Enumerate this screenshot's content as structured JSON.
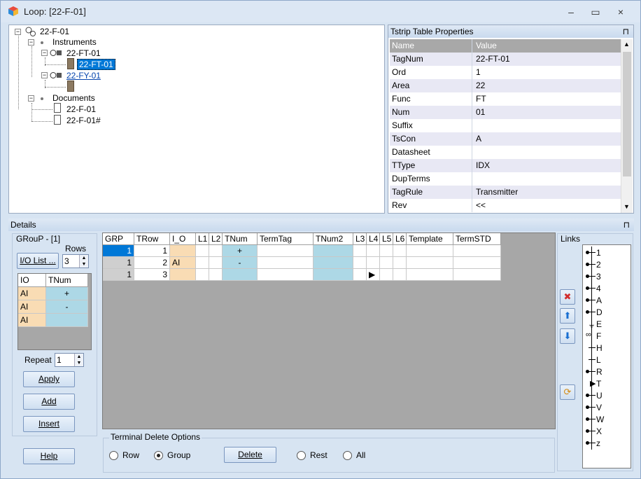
{
  "window": {
    "title": "Loop: [22-F-01]",
    "minimize": "–",
    "maximize": "▭",
    "close": "×"
  },
  "tree": {
    "root": "22-F-01",
    "instruments": "Instruments",
    "ft": "22-FT-01",
    "ft_child": "22-FT-01",
    "fy": "22-FY-01",
    "documents": "Documents",
    "doc1": "22-F-01",
    "doc2": "22-F-01#"
  },
  "props": {
    "header": "Tstrip Table Properties",
    "pin": "⊓",
    "col_name": "Name",
    "col_value": "Value",
    "rows": [
      {
        "name": "TagNum",
        "value": "22-FT-01"
      },
      {
        "name": "Ord",
        "value": "1"
      },
      {
        "name": "Area",
        "value": "22"
      },
      {
        "name": "Func",
        "value": "FT"
      },
      {
        "name": "Num",
        "value": "01"
      },
      {
        "name": "Suffix",
        "value": ""
      },
      {
        "name": "TsCon",
        "value": "A"
      },
      {
        "name": "Datasheet",
        "value": ""
      },
      {
        "name": "TType",
        "value": "IDX"
      },
      {
        "name": "DupTerms",
        "value": ""
      },
      {
        "name": "TagRule",
        "value": "Transmitter"
      },
      {
        "name": "Rev",
        "value": "<<"
      }
    ]
  },
  "details": {
    "header": "Details",
    "pin": "⊓",
    "group_title": "GRouP - [1]",
    "rows_label": "Rows",
    "rows_value": "3",
    "io_list_button": "I/O List ...",
    "io_grid": {
      "headers": [
        "IO",
        "TNum"
      ],
      "rows": [
        [
          "AI",
          "+"
        ],
        [
          "AI",
          "-"
        ],
        [
          "AI",
          ""
        ]
      ]
    },
    "repeat_label": "Repeat",
    "repeat_value": "1",
    "apply": "Apply",
    "add": "Add",
    "insert": "Insert",
    "help": "Help"
  },
  "grid": {
    "headers": [
      "GRP",
      "TRow",
      "I_O",
      "L1",
      "L2",
      "TNum",
      "TermTag",
      "TNum2",
      "L3",
      "L4",
      "L5",
      "L6",
      "Template",
      "TermSTD"
    ],
    "rows": [
      [
        "1",
        "1",
        "",
        "",
        "",
        "+",
        "",
        "",
        "",
        "",
        "",
        "",
        "",
        ""
      ],
      [
        "1",
        "2",
        "AI",
        "",
        "",
        "-",
        "",
        "",
        "",
        "",
        "",
        "",
        "",
        ""
      ],
      [
        "1",
        "3",
        "",
        "",
        "",
        "",
        "",
        "",
        "",
        "▶",
        "",
        "",
        "",
        ""
      ]
    ]
  },
  "delete_options": {
    "title": "Terminal Delete Options",
    "row": "Row",
    "group": "Group",
    "delete": "Delete",
    "rest": "Rest",
    "all": "All",
    "selected": "Group"
  },
  "links": {
    "title": "Links",
    "items": [
      "1",
      "2",
      "3",
      "4",
      "A",
      "D",
      "E",
      "F",
      "H",
      "L",
      "R",
      "T",
      "U",
      "V",
      "W",
      "X",
      "z"
    ]
  },
  "colors": {
    "selection": "#0078d7",
    "orange_cell": "#f9dcb4",
    "blue_cell": "#add8e6",
    "grid_bg": "#a7a7a7",
    "panel_bg": "#d7e4f2"
  }
}
